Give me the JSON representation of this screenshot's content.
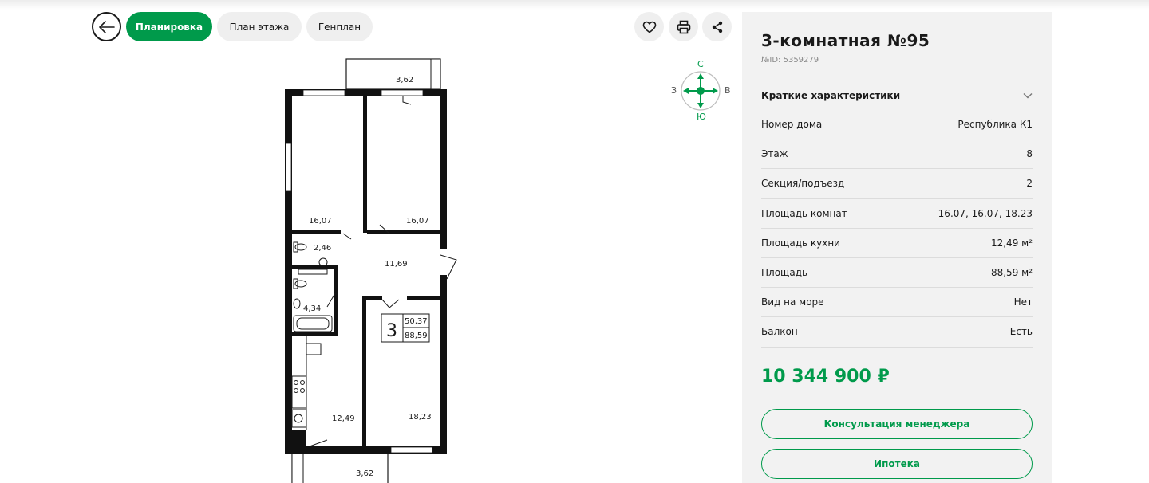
{
  "nav": {
    "tabs": [
      {
        "label": "Планировка",
        "active": true
      },
      {
        "label": "План этажа",
        "active": false
      },
      {
        "label": "Генплан",
        "active": false
      }
    ],
    "actions": [
      "heart-icon",
      "print-icon",
      "share-icon"
    ]
  },
  "compass": {
    "north": "С",
    "south": "Ю",
    "west": "З",
    "east": "В"
  },
  "plan": {
    "balcony_top": "3,62",
    "room_left": "16,07",
    "room_right": "16,07",
    "bathroom_small": "2,46",
    "hall": "11,69",
    "bathroom": "4,34",
    "kitchen": "12,49",
    "room_bottom": "18,23",
    "balcony_bottom": "3,62",
    "badge_rooms": "3",
    "badge_living": "50,37",
    "badge_total": "88,59"
  },
  "apartment": {
    "title": "3-комнатная №95",
    "id": "№ID: 5359279",
    "specs_title": "Краткие характеристики",
    "specs": [
      {
        "label": "Номер дома",
        "value": "Республика К1"
      },
      {
        "label": "Этаж",
        "value": "8"
      },
      {
        "label": "Секция/подъезд",
        "value": "2"
      },
      {
        "label": "Площадь комнат",
        "value": "16.07, 16.07, 18.23"
      },
      {
        "label": "Площадь кухни",
        "value": "12,49 м²"
      },
      {
        "label": "Площадь",
        "value": "88,59 м²"
      },
      {
        "label": "Вид на море",
        "value": "Нет"
      },
      {
        "label": "Балкон",
        "value": "Есть"
      }
    ],
    "price": "10 344 900 ₽",
    "consult_label": "Консультация менеджера",
    "mortgage_label": "Ипотека"
  },
  "colors": {
    "accent": "#009a4b",
    "panel": "#f2f2f2",
    "pill": "#efefef"
  }
}
